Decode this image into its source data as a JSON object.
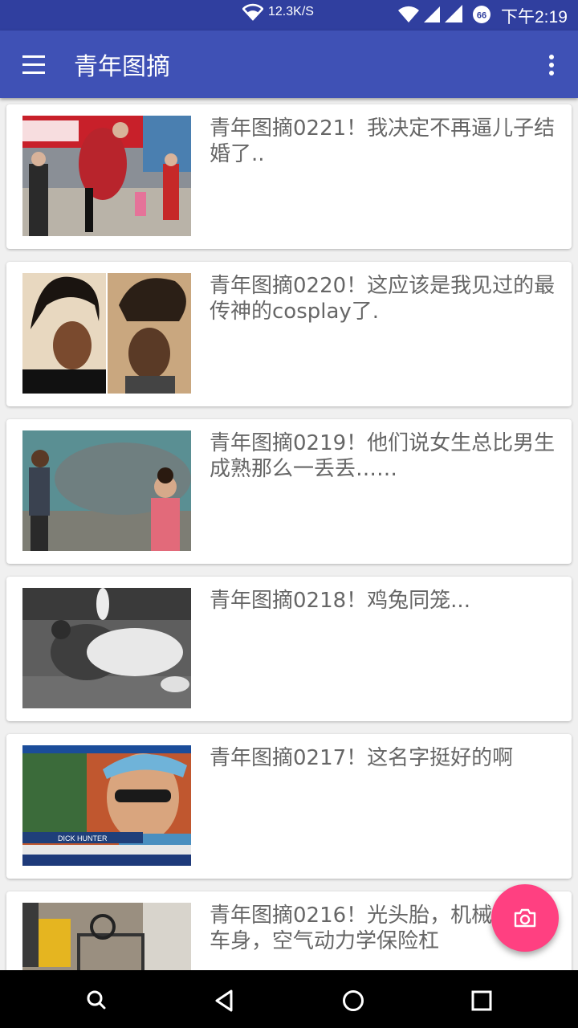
{
  "status_bar": {
    "net_speed": "12.3K/S",
    "time": "下午2:19",
    "battery": "66"
  },
  "app_bar": {
    "title": "青年图摘"
  },
  "articles": [
    {
      "title": "青年图摘0221！我决定不再逼儿子结婚了.."
    },
    {
      "title": "青年图摘0220！这应该是我见过的最传神的cosplay了."
    },
    {
      "title": "青年图摘0219！他们说女生总比男生成熟那么一丢丢……"
    },
    {
      "title": "青年图摘0218！鸡兔同笼..."
    },
    {
      "title": "青年图摘0217！这名字挺好的啊"
    },
    {
      "title": "青年图摘0216！光头胎，机械防滚架车身，空气动力学保险杠"
    }
  ],
  "fab": {
    "icon": "camera-icon"
  },
  "nav_bar": {
    "icons": [
      "search-icon",
      "back-icon",
      "home-icon",
      "recents-icon"
    ]
  },
  "colors": {
    "status_bar": "#303f9f",
    "app_bar": "#3f51b5",
    "fab": "#ff4081",
    "background": "#f0f0f0"
  }
}
